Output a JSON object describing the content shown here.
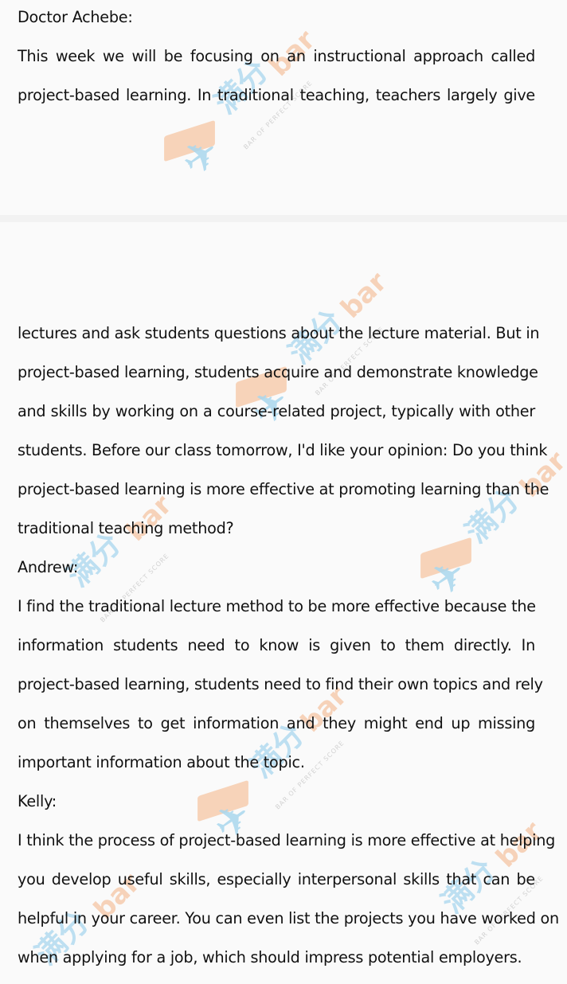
{
  "watermark": {
    "chinese": "满分",
    "brand": "bar",
    "tagline": "BAR OF PERFECT SCORE",
    "plane_glyph": "✈",
    "colors": {
      "blue": "#a9d7ee",
      "orange": "#f6c9a9"
    }
  },
  "page1": {
    "lines": [
      "Doctor Achebe:",
      "This week we will be focusing on an instructional approach called",
      "project-based learning. In traditional teaching, teachers largely give"
    ]
  },
  "page2": {
    "lines": [
      "lectures and ask students questions about the lecture material. But in",
      "project-based learning, students acquire and demonstrate knowledge",
      "and skills by working on a course-related project, typically with other",
      "students. Before our class tomorrow, I'd like your opinion: Do you think",
      "project-based learning is more effective at promoting learning than the",
      "traditional teaching method?",
      "Andrew:",
      "I find the traditional lecture method to be more effective because the",
      "information students need to know is given to them directly. In",
      "project-based learning, students need to find their own topics and rely",
      "on themselves to get information and they might end up missing",
      "important information about the topic.",
      "Kelly:",
      "I think the process of project-based learning is more effective at helping",
      "you develop useful skills, especially interpersonal skills that can be",
      "helpful in your career. You can even list the projects you have worked on",
      "when applying for a job, which should impress potential employers."
    ]
  }
}
